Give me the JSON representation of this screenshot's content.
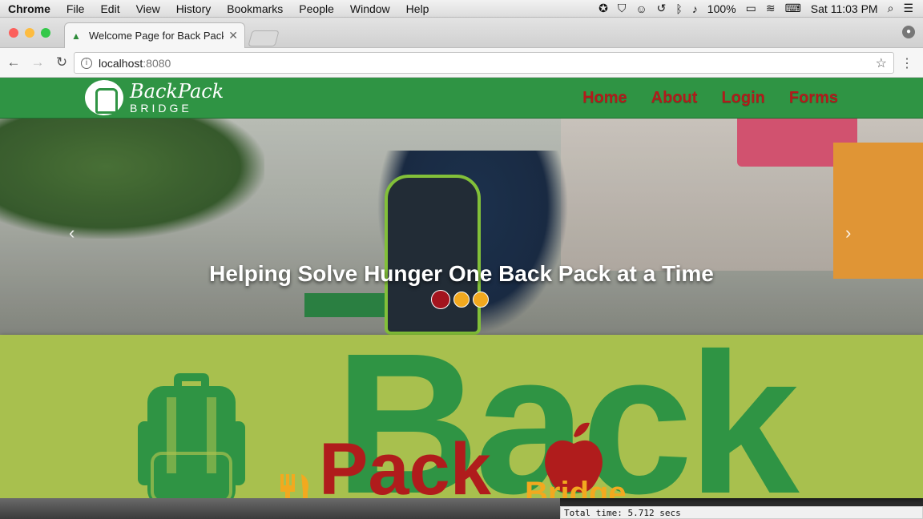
{
  "menubar": {
    "items": [
      "Chrome",
      "File",
      "Edit",
      "View",
      "History",
      "Bookmarks",
      "People",
      "Window",
      "Help"
    ],
    "battery": "100%",
    "clock": "Sat 11:03 PM"
  },
  "tab": {
    "title": "Welcome Page for Back Pack"
  },
  "address": {
    "host": "localhost",
    "port": ":8080"
  },
  "site": {
    "logo_top": "BackPack",
    "logo_bottom": "BRIDGE",
    "nav": [
      "Home",
      "About",
      "Login",
      "Forms"
    ]
  },
  "hero": {
    "caption": "Helping Solve Hunger One Back Pack at a Time",
    "prev": "‹",
    "next": "›"
  },
  "banner": {
    "word1": "Back",
    "word2": "Pack",
    "word3": "Bridge"
  },
  "status": {
    "text": "Total time: 5.712 secs"
  },
  "colors": {
    "nav_green": "#2f9444",
    "link_red": "#b21b1b",
    "banner_olive": "#a8c04e",
    "accent_orange": "#f2a91f"
  }
}
